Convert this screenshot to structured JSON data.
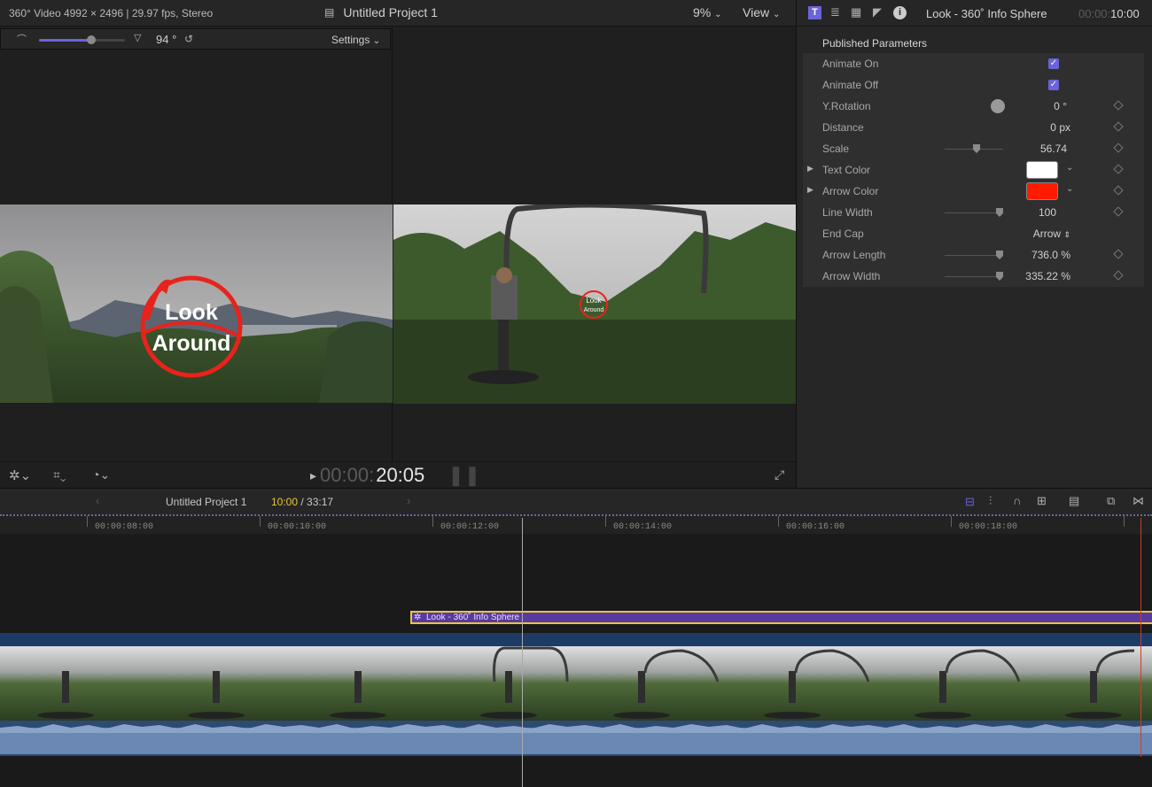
{
  "topbar": {
    "format": "360° Video 4992 × 2496 | 29.97 fps, Stereo",
    "project_title": "Untitled Project 1",
    "zoom": "9%",
    "view_label": "View"
  },
  "viewer360": {
    "angle_value": "94 °",
    "settings_label": "Settings",
    "overlay_text_line1": "Look",
    "overlay_text_line2": "Around"
  },
  "viewer": {
    "overlay_text_line1": "Look",
    "overlay_text_line2": "Around",
    "timecode_dim": "00:00:",
    "timecode_bright": "20:05"
  },
  "inspector": {
    "title": "Look  - 360˚ Info Sphere",
    "duration_dim": "00:00:",
    "duration_bright": "10:00",
    "section_header": "Published Parameters",
    "params": [
      {
        "label": "Animate On",
        "value": ""
      },
      {
        "label": "Animate Off",
        "value": ""
      },
      {
        "label": "Y.Rotation",
        "value": "0",
        "unit": "°"
      },
      {
        "label": "Distance",
        "value": "0",
        "unit": "px"
      },
      {
        "label": "Scale",
        "value": "56.74",
        "unit": ""
      },
      {
        "label": "Text Color",
        "value": ""
      },
      {
        "label": "Arrow Color",
        "value": ""
      },
      {
        "label": "Line Width",
        "value": "100",
        "unit": ""
      },
      {
        "label": "End Cap",
        "value": "Arrow"
      },
      {
        "label": "Arrow Length",
        "value": "736.0",
        "unit": "%"
      },
      {
        "label": "Arrow Width",
        "value": "335.22",
        "unit": "%"
      }
    ],
    "text_color": "#ffffff",
    "arrow_color": "#ff1a00"
  },
  "timeline": {
    "project_name": "Untitled Project 1",
    "position_current": "10:00",
    "position_total": "/ 33:17",
    "ruler_labels": [
      "00:00:08:00",
      "00:00:10:00",
      "00:00:12:00",
      "00:00:14:00",
      "00:00:16:00",
      "00:00:18:00"
    ],
    "title_clip_label": "Look  - 360˚ Info Sphere"
  },
  "colors": {
    "accent_purple": "#6b63d9",
    "playhead_yellow": "#e8c63c",
    "clip_purple": "#5a3aa0"
  }
}
